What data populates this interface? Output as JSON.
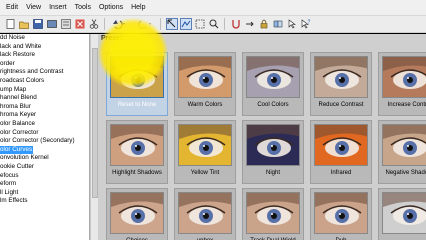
{
  "menu": [
    "Edit",
    "View",
    "Insert",
    "Tools",
    "Options",
    "Help"
  ],
  "sidebar": {
    "items": [
      "dd Noise",
      "lack and White",
      "lack Restore",
      "order",
      "rightness and Contrast",
      "roadcast Colors",
      "ump Map",
      "hannel Blend",
      "hroma Blur",
      "hroma Keyer",
      "olor Balance",
      "olor Corrector",
      "olor Corrector (Secondary)",
      "olor Curves",
      "onvolution Kernel",
      "ookie Cutter",
      "efocus",
      "eform",
      "ll Light",
      "lm Effects"
    ],
    "selected_index": 13
  },
  "presets": {
    "label": "Preset:",
    "tiles": [
      {
        "name": "Reset to None",
        "tint": "#c9a24a",
        "selected": true
      },
      {
        "name": "Warm Colors",
        "tint": "#d39a6c"
      },
      {
        "name": "Cool Colors",
        "tint": "#a6a0b0"
      },
      {
        "name": "Reduce Contrast",
        "tint": "#c4aa98"
      },
      {
        "name": "Increase Contra",
        "tint": "#b57a5c"
      },
      {
        "name": "Highlight Shadows",
        "tint": "#cfa080"
      },
      {
        "name": "Yellow Tint",
        "tint": "#e3b531"
      },
      {
        "name": "Night",
        "tint": "#2b2b55"
      },
      {
        "name": "Infrared",
        "tint": "#e06820"
      },
      {
        "name": "Negative Shadow",
        "tint": "#c6a58a"
      },
      {
        "name": "Choices",
        "tint": "#cca58c"
      },
      {
        "name": "unbox",
        "tint": "#cba48b"
      },
      {
        "name": "Track Dual Wield",
        "tint": "#c9a38a"
      },
      {
        "name": "Dub",
        "tint": "#caa38a"
      },
      {
        "name": "",
        "tint": "#cfcfcf"
      }
    ]
  },
  "colors": {
    "selection": "#3399ff",
    "highlight": "#ffea00"
  }
}
